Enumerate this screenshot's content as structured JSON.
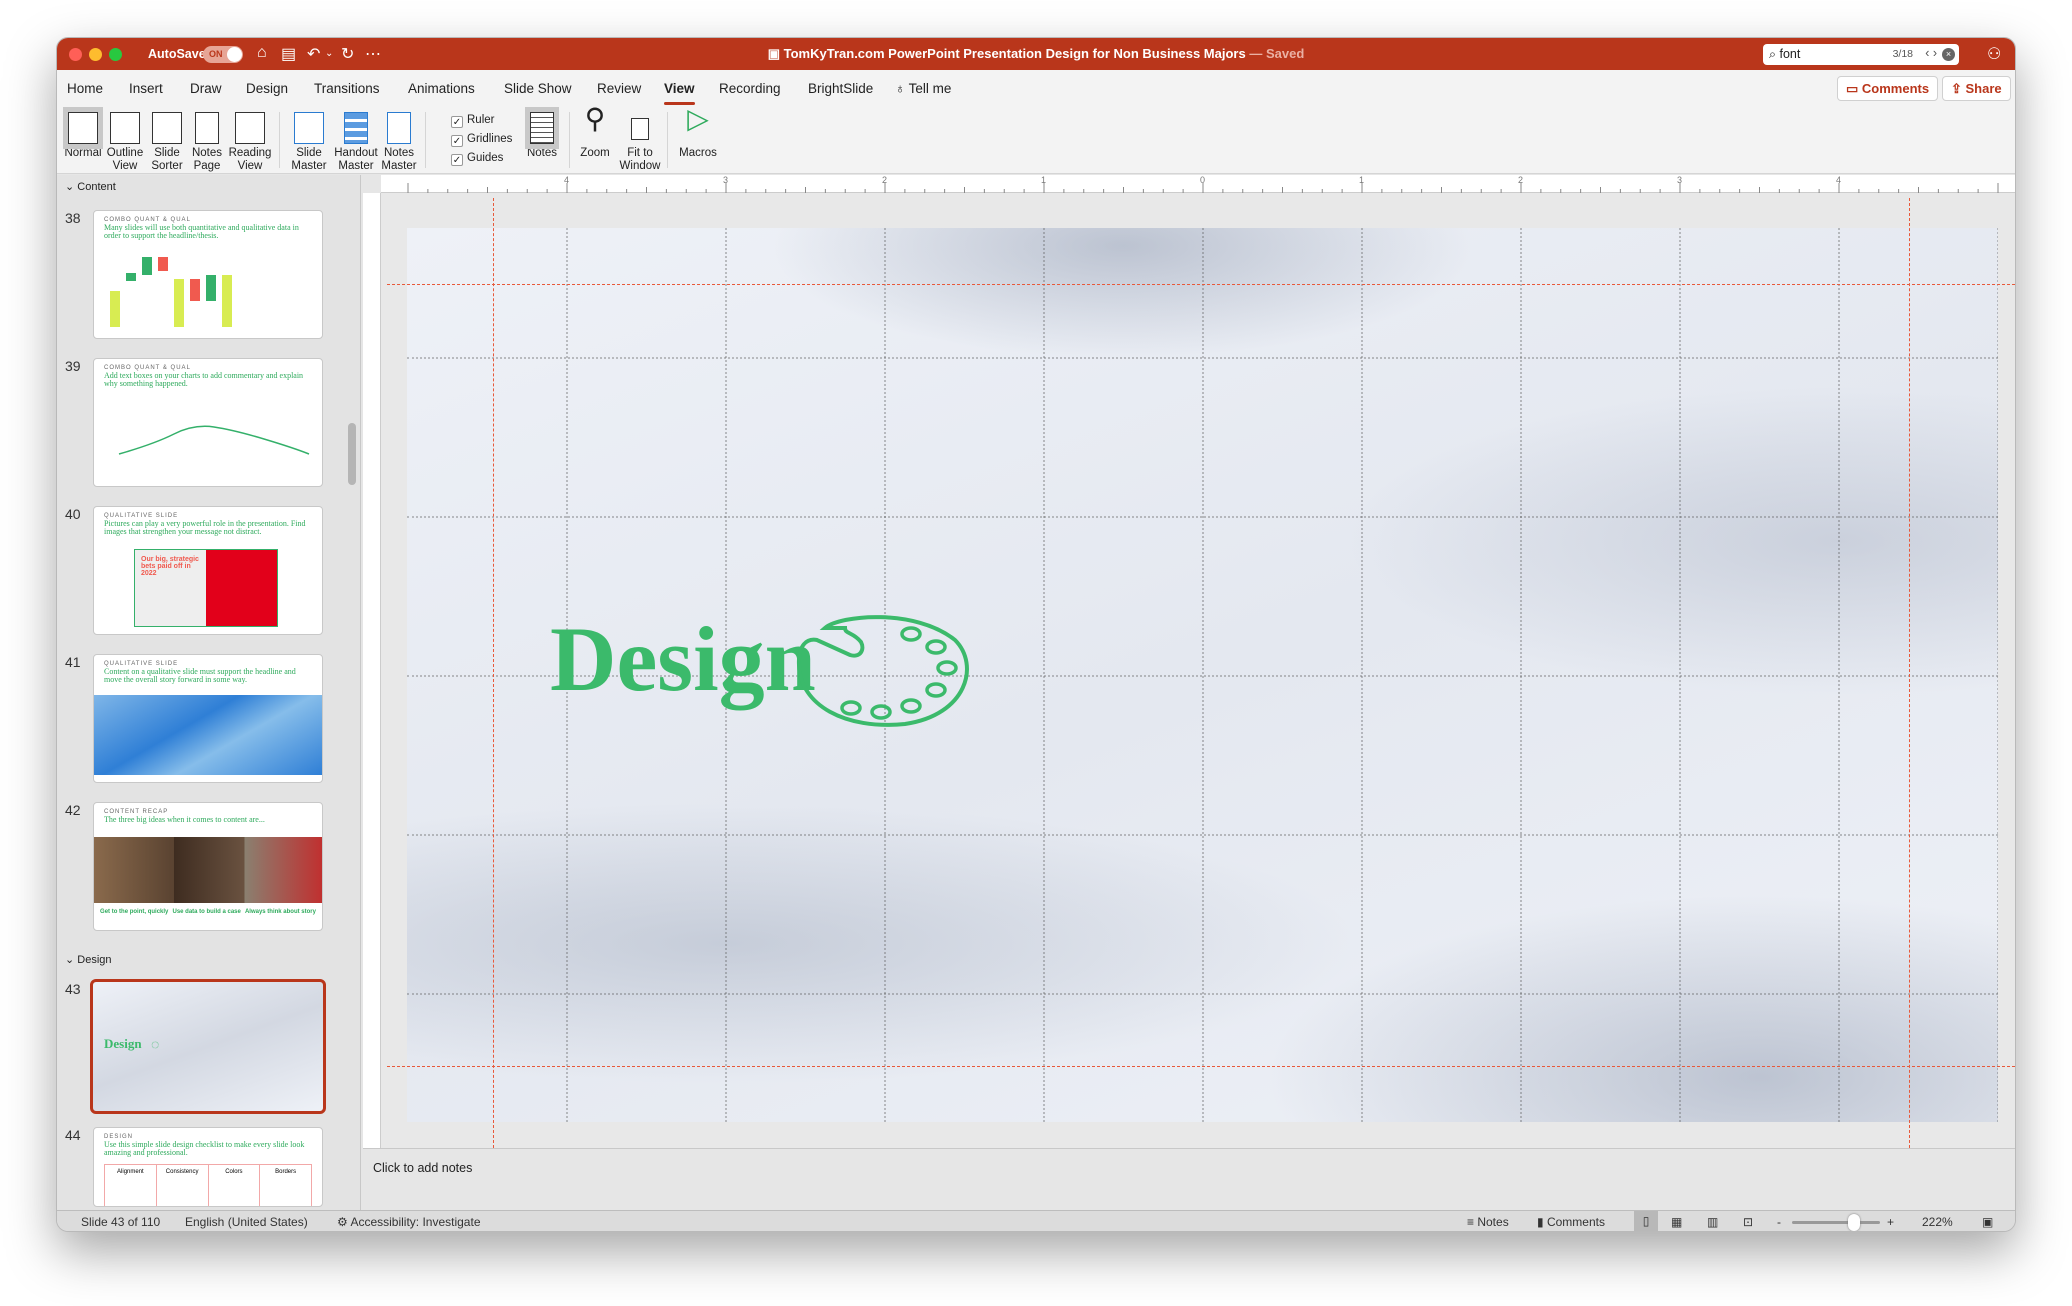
{
  "titlebar": {
    "autosave_label": "AutoSave",
    "autosave_state": "ON",
    "title": "TomKyTran.com PowerPoint Presentation Design for Non Business Majors",
    "saved": "— Saved",
    "search_value": "font",
    "search_count": "3/18",
    "accent": "#b9361b"
  },
  "tabs": [
    "Home",
    "Insert",
    "Draw",
    "Design",
    "Transitions",
    "Animations",
    "Slide Show",
    "Review",
    "View",
    "Recording",
    "BrightSlide",
    "Tell me"
  ],
  "active_tab": "View",
  "actions": {
    "comments": "Comments",
    "share": "Share"
  },
  "ribbon": {
    "views": [
      {
        "l1": "Normal",
        "l2": ""
      },
      {
        "l1": "Outline",
        "l2": "View"
      },
      {
        "l1": "Slide",
        "l2": "Sorter"
      },
      {
        "l1": "Notes",
        "l2": "Page"
      },
      {
        "l1": "Reading",
        "l2": "View"
      }
    ],
    "masters": [
      {
        "l1": "Slide",
        "l2": "Master"
      },
      {
        "l1": "Handout",
        "l2": "Master"
      },
      {
        "l1": "Notes",
        "l2": "Master"
      }
    ],
    "checks": [
      {
        "label": "Ruler",
        "checked": true
      },
      {
        "label": "Gridlines",
        "checked": true
      },
      {
        "label": "Guides",
        "checked": true
      }
    ],
    "notes": "Notes",
    "zoom": "Zoom",
    "fit1": "Fit to",
    "fit2": "Window",
    "macros": "Macros"
  },
  "ruler_labels": [
    "4",
    "3",
    "2",
    "1",
    "0",
    "1",
    "2",
    "3",
    "4"
  ],
  "sections": [
    {
      "label": "Content"
    },
    {
      "label": "Design"
    }
  ],
  "slides": [
    {
      "num": "38",
      "kicker": "COMBO QUANT & QUAL",
      "headline": "Many slides will use both quantitative and qualitative data in order to support the headline/thesis."
    },
    {
      "num": "39",
      "kicker": "COMBO QUANT & QUAL",
      "headline": "Add text boxes on your charts to add commentary and explain why something happened."
    },
    {
      "num": "40",
      "kicker": "QUALITATIVE SLIDE",
      "headline": "Pictures can play a very powerful role in the presentation. Find images that strengthen your message not distract.",
      "image_text": "Our big, strategic bets paid off in 2022"
    },
    {
      "num": "41",
      "kicker": "QUALITATIVE SLIDE",
      "headline": "Content on a qualitative slide must support the headline and move the overall story forward in some way."
    },
    {
      "num": "42",
      "kicker": "CONTENT RECAP",
      "headline": "The three big ideas when it comes to content are...",
      "captions": [
        "Get to the point, quickly",
        "Use data to build a case",
        "Always think about story"
      ]
    },
    {
      "num": "43",
      "title": "Design",
      "selected": true
    },
    {
      "num": "44",
      "kicker": "DESIGN",
      "headline": "Use this simple slide design checklist to make every slide look amazing and professional.",
      "cols": [
        "Alignment",
        "Consistency",
        "Colors",
        "Borders"
      ]
    }
  ],
  "slide": {
    "title": "Design",
    "icon": "palette-icon",
    "text_color": "#3bba6b"
  },
  "notes_placeholder": "Click to add notes",
  "status": {
    "slide": "Slide 43 of 110",
    "language": "English (United States)",
    "accessibility": "Accessibility: Investigate",
    "notes": "Notes",
    "comments": "Comments",
    "zoom": "222%",
    "zoom_level_percent": 222
  }
}
